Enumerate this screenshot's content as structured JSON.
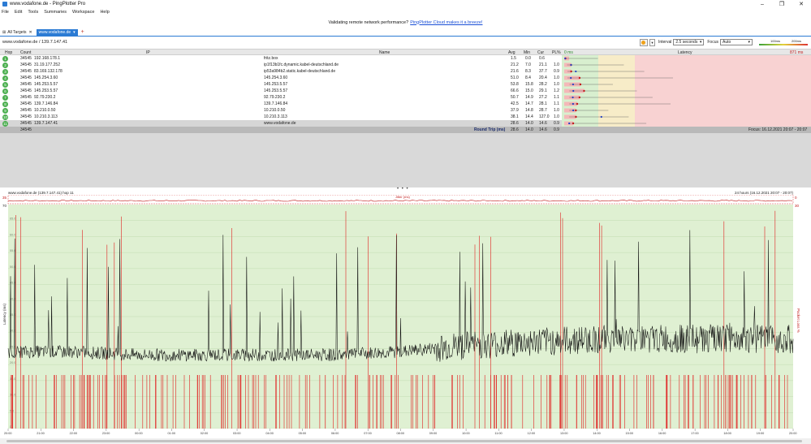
{
  "window": {
    "title": "www.vodafone.de - PingPlotter Pro",
    "controls": [
      "–",
      "❐",
      "✕"
    ]
  },
  "menu": [
    "File",
    "Edit",
    "Tools",
    "Summaries",
    "Workspace",
    "Help"
  ],
  "banner": {
    "text": "Validating remote network performance?",
    "link": "PingPlotter Cloud makes it a breeze!"
  },
  "tabs": {
    "all_targets": "All Targets",
    "active": "www.vodafone.de",
    "add": "+"
  },
  "toolbar": {
    "target": "www.vodafone.de / 139.7.147.41",
    "interval_label": "Interval",
    "interval_value": "2.5 seconds",
    "focus_label": "Focus",
    "focus_value": "Auto",
    "scale_low": "100ms",
    "scale_high": "200ms"
  },
  "table": {
    "headers": {
      "hop": "Hop",
      "count": "Count",
      "ip": "IP",
      "name": "Name",
      "avg": "Avg",
      "min": "Min",
      "cur": "Cur",
      "pl": "PL%",
      "zero": "0 ms",
      "latency": "Latency",
      "max": "871 ms"
    },
    "rows": [
      {
        "hop": "1",
        "count": "34545",
        "ip": "192.168.178.1",
        "name": "fritz.box",
        "avg": "1.5",
        "min": "0.0",
        "cur": "0.6",
        "pl": "",
        "status": "#4caf50"
      },
      {
        "hop": "2",
        "count": "34545",
        "ip": "31.19.177.252",
        "name": "ip1f13b1fc.dynamic.kabel-deutschland.de",
        "avg": "21.2",
        "min": "7.0",
        "cur": "21.1",
        "pl": "1.0",
        "status": "#4caf50"
      },
      {
        "hop": "3",
        "count": "34545",
        "ip": "83.169.132.178",
        "name": "ip53a984b2.static.kabel-deutschland.de",
        "avg": "21.6",
        "min": "8.3",
        "cur": "37.7",
        "pl": "0.9",
        "status": "#4caf50"
      },
      {
        "hop": "4",
        "count": "34545",
        "ip": "145.254.3.60",
        "name": "145.254.3.60",
        "avg": "51.0",
        "min": "8.4",
        "cur": "20.4",
        "pl": "1.0",
        "status": "#4caf50"
      },
      {
        "hop": "5",
        "count": "34545",
        "ip": "145.253.5.57",
        "name": "145.253.5.57",
        "avg": "53.8",
        "min": "15.8",
        "cur": "28.2",
        "pl": "1.0",
        "status": "#4caf50"
      },
      {
        "hop": "6",
        "count": "34545",
        "ip": "145.253.5.57",
        "name": "145.253.5.57",
        "avg": "66.6",
        "min": "15.0",
        "cur": "29.1",
        "pl": "1.2",
        "status": "#4caf50"
      },
      {
        "hop": "7",
        "count": "34545",
        "ip": "92.79.230.2",
        "name": "92.79.230.2",
        "avg": "50.7",
        "min": "14.9",
        "cur": "27.2",
        "pl": "1.1",
        "status": "#4caf50"
      },
      {
        "hop": "8",
        "count": "34545",
        "ip": "139.7.146.84",
        "name": "139.7.146.84",
        "avg": "42.5",
        "min": "14.7",
        "cur": "28.1",
        "pl": "1.1",
        "status": "#4caf50"
      },
      {
        "hop": "9",
        "count": "34545",
        "ip": "10.210.0.50",
        "name": "10.210.0.50",
        "avg": "37.9",
        "min": "14.8",
        "cur": "28.7",
        "pl": "1.0",
        "status": "#4caf50"
      },
      {
        "hop": "10",
        "count": "34545",
        "ip": "10.210.3.113",
        "name": "10.210.3.113",
        "avg": "38.1",
        "min": "14.4",
        "cur": "127.0",
        "pl": "1.0",
        "status": "#4caf50"
      },
      {
        "hop": "11",
        "count": "34545",
        "ip": "139.7.147.41",
        "name": "www.vodafone.de",
        "avg": "28.6",
        "min": "14.0",
        "cur": "14.6",
        "pl": "0.9",
        "status": "#4caf50",
        "focus": true
      }
    ],
    "summary": {
      "count": "34545",
      "label": "Round Trip (ms)",
      "avg": "28.6",
      "min": "14.0",
      "cur": "14.6",
      "pl": "0.9",
      "focus": "Focus: 16.12.2021 20:07 - 20:07"
    }
  },
  "timeline": {
    "title": "www.vodafone.de (139.7.147.41) hop 11",
    "range": "24 hours (16.12.2021 20:07 - 20:07)",
    "jitter_label": "Jitter (ms)",
    "y_left_label": "Latency (ms)",
    "y_right_label": "Packet Loss %",
    "y_top_left": "70",
    "y_top_right": "30",
    "strip_left": "35",
    "strip_right": "0",
    "y_ticks": [
      "65.0",
      "60.0",
      "55.0",
      "50.0",
      "45.0",
      "40.0",
      "35.0",
      "30.0",
      "25.0",
      "20.0",
      "15.0",
      "10.0",
      "5.0",
      "0"
    ],
    "x_ticks": [
      "20:00",
      "21:00",
      "22:00",
      "23:00",
      "00:00",
      "01:00",
      "02:00",
      "03:00",
      "04:00",
      "05:00",
      "06:00",
      "07:00",
      "08:00",
      "09:00",
      "10:00",
      "11:00",
      "12:00",
      "13:00",
      "14:00",
      "15:00",
      "16:00",
      "17:00",
      "18:00",
      "19:00",
      "20:00"
    ],
    "colors": {
      "background": "#dff0d2",
      "latency_line": "#111111",
      "loss_bar": "#e02020",
      "strip_line": "#c01818"
    }
  },
  "chart_data": {
    "type": "line",
    "y_left_label": "Latency (ms)",
    "y_right_label": "Packet Loss %",
    "ylim": [
      0,
      70
    ],
    "x": [
      "20:00",
      "22:00",
      "00:00",
      "02:00",
      "04:00",
      "06:00",
      "08:00",
      "10:00",
      "12:00",
      "14:00",
      "16:00",
      "18:00",
      "20:00"
    ],
    "series": [
      {
        "values": [
          24,
          24,
          23,
          23,
          23,
          23,
          24,
          26,
          27,
          28,
          28,
          28,
          28
        ]
      }
    ]
  }
}
